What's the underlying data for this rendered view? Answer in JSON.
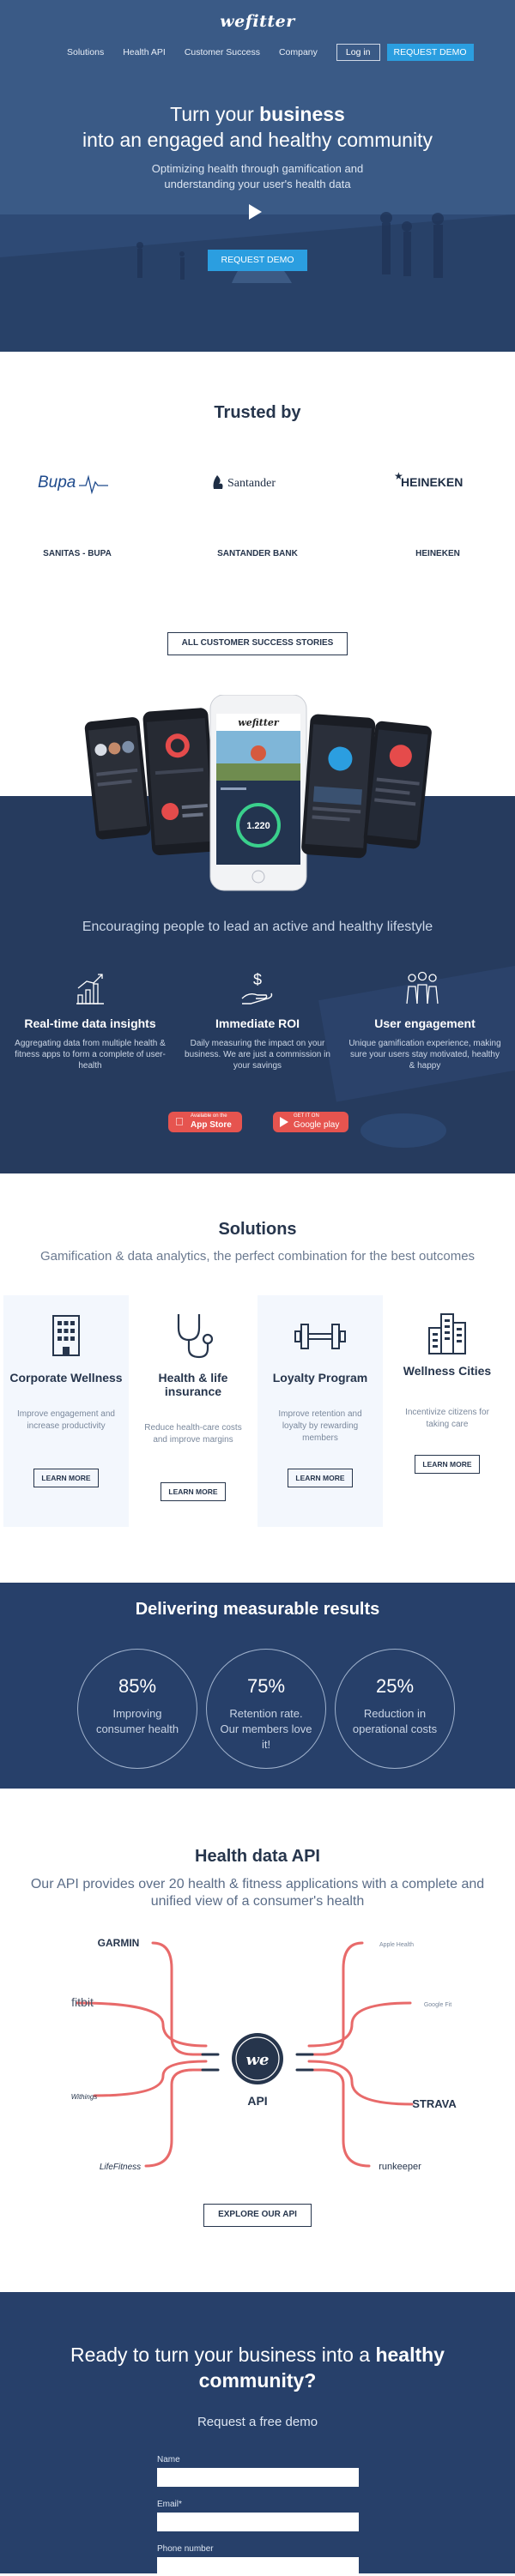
{
  "header": {
    "logo": "wefitter",
    "nav": [
      "Solutions",
      "Health API",
      "Customer Success",
      "Company"
    ],
    "login": "Log in",
    "request_demo": "REQUEST DEMO"
  },
  "hero": {
    "title_pre": "Turn your ",
    "title_bold": "business",
    "title_post": " into an engaged and healthy community",
    "subtitle": "Optimizing health through gamification and understanding your user's health data",
    "cta": "REQUEST DEMO"
  },
  "trusted": {
    "title": "Trusted by",
    "logos": [
      "Bupa",
      "Santander",
      "HEINEKEN"
    ],
    "names": [
      "SANITAS - BUPA",
      "SANTANDER BANK",
      "HEINEKEN"
    ],
    "button": "ALL CUSTOMER SUCCESS STORIES"
  },
  "phones": {
    "center_logo": "wefitter",
    "center_value": "1.220"
  },
  "lifestyle": {
    "title": "Encouraging people to lead an active and healthy lifestyle",
    "features": [
      {
        "title": "Real-time data insights",
        "text": "Aggregating data from multiple health & fitness apps to form a complete of user-health",
        "icon": "chart-icon"
      },
      {
        "title": "Immediate ROI",
        "text": "Daily measuring the impact on your business. We are just a commission in your savings",
        "icon": "money-hand-icon"
      },
      {
        "title": "User engagement",
        "text": "Unique gamification experience, making sure your users stay motivated, healthy & happy",
        "icon": "users-icon"
      }
    ],
    "stores": [
      {
        "small": "Available on the",
        "big": "App Store"
      },
      {
        "small": "GET IT ON",
        "big": "Google play"
      }
    ]
  },
  "solutions": {
    "title": "Solutions",
    "subtitle": "Gamification & data analytics, the perfect combination for the best outcomes",
    "cards": [
      {
        "title": "Corporate Wellness",
        "text": "Improve engagement and increase productivity",
        "button": "LEARN MORE",
        "icon": "building-icon"
      },
      {
        "title": "Health & life insurance",
        "text": "Reduce health-care costs and improve margins",
        "button": "LEARN MORE",
        "icon": "stethoscope-icon"
      },
      {
        "title": "Loyalty Program",
        "text": "Improve retention and loyalty by rewarding members",
        "button": "LEARN MORE",
        "icon": "dumbbell-icon"
      },
      {
        "title": "Wellness Cities",
        "text": "Incentivize citizens for taking care",
        "button": "LEARN MORE",
        "icon": "city-icon"
      }
    ]
  },
  "results": {
    "title": "Delivering measurable results",
    "items": [
      {
        "value": "85%",
        "label": "Improving consumer health"
      },
      {
        "value": "75%",
        "label": "Retention rate. Our members love it!"
      },
      {
        "value": "25%",
        "label": "Reduction in operational costs"
      }
    ]
  },
  "api": {
    "title": "Health data API",
    "subtitle": "Our API provides over 20 health & fitness applications with a complete and unified view of a consumer's health",
    "center_logo": "we",
    "center_label": "API",
    "partners_left": [
      "GARMIN",
      "fitbit",
      "Withings",
      "LifeFitness"
    ],
    "partners_right": [
      "Apple Health",
      "Google Fit",
      "STRAVA",
      "runkeeper"
    ],
    "button": "EXPLORE OUR API"
  },
  "cta": {
    "title_pre": "Ready to turn your business into a ",
    "title_bold": "healthy community?",
    "subtitle": "Request a free demo",
    "fields": [
      "Name",
      "Email*",
      "Phone number"
    ]
  }
}
